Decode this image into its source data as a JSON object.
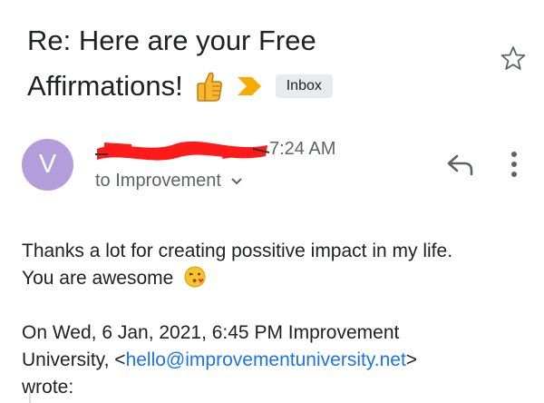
{
  "subject": {
    "line1": "Re: Here are your Free",
    "line2": "Affirmations!"
  },
  "label": "Inbox",
  "sender": {
    "avatar_letter": "V",
    "time": "7:24 AM",
    "recipient": "to Improvement"
  },
  "message": {
    "line1": "Thanks a lot for creating possitive impact in my life.",
    "line2": "You are awesome",
    "quote_line1": "On Wed, 6 Jan, 2021, 6:45 PM Improvement",
    "quote_line2_prefix": "University, <",
    "quote_email": "hello@improvementuniversity.net",
    "quote_line2_suffix": ">",
    "quote_line3": "wrote:"
  },
  "colors": {
    "avatar": "#b39ddb",
    "importance_marker": "#f9ab00",
    "link": "#1a73e8",
    "redaction": "#ff1a1a"
  },
  "icons": [
    "thumbs-up-emoji",
    "importance-chevron",
    "star-icon",
    "reply-icon",
    "more-vert-icon",
    "chevron-down-icon",
    "kiss-emoji"
  ]
}
